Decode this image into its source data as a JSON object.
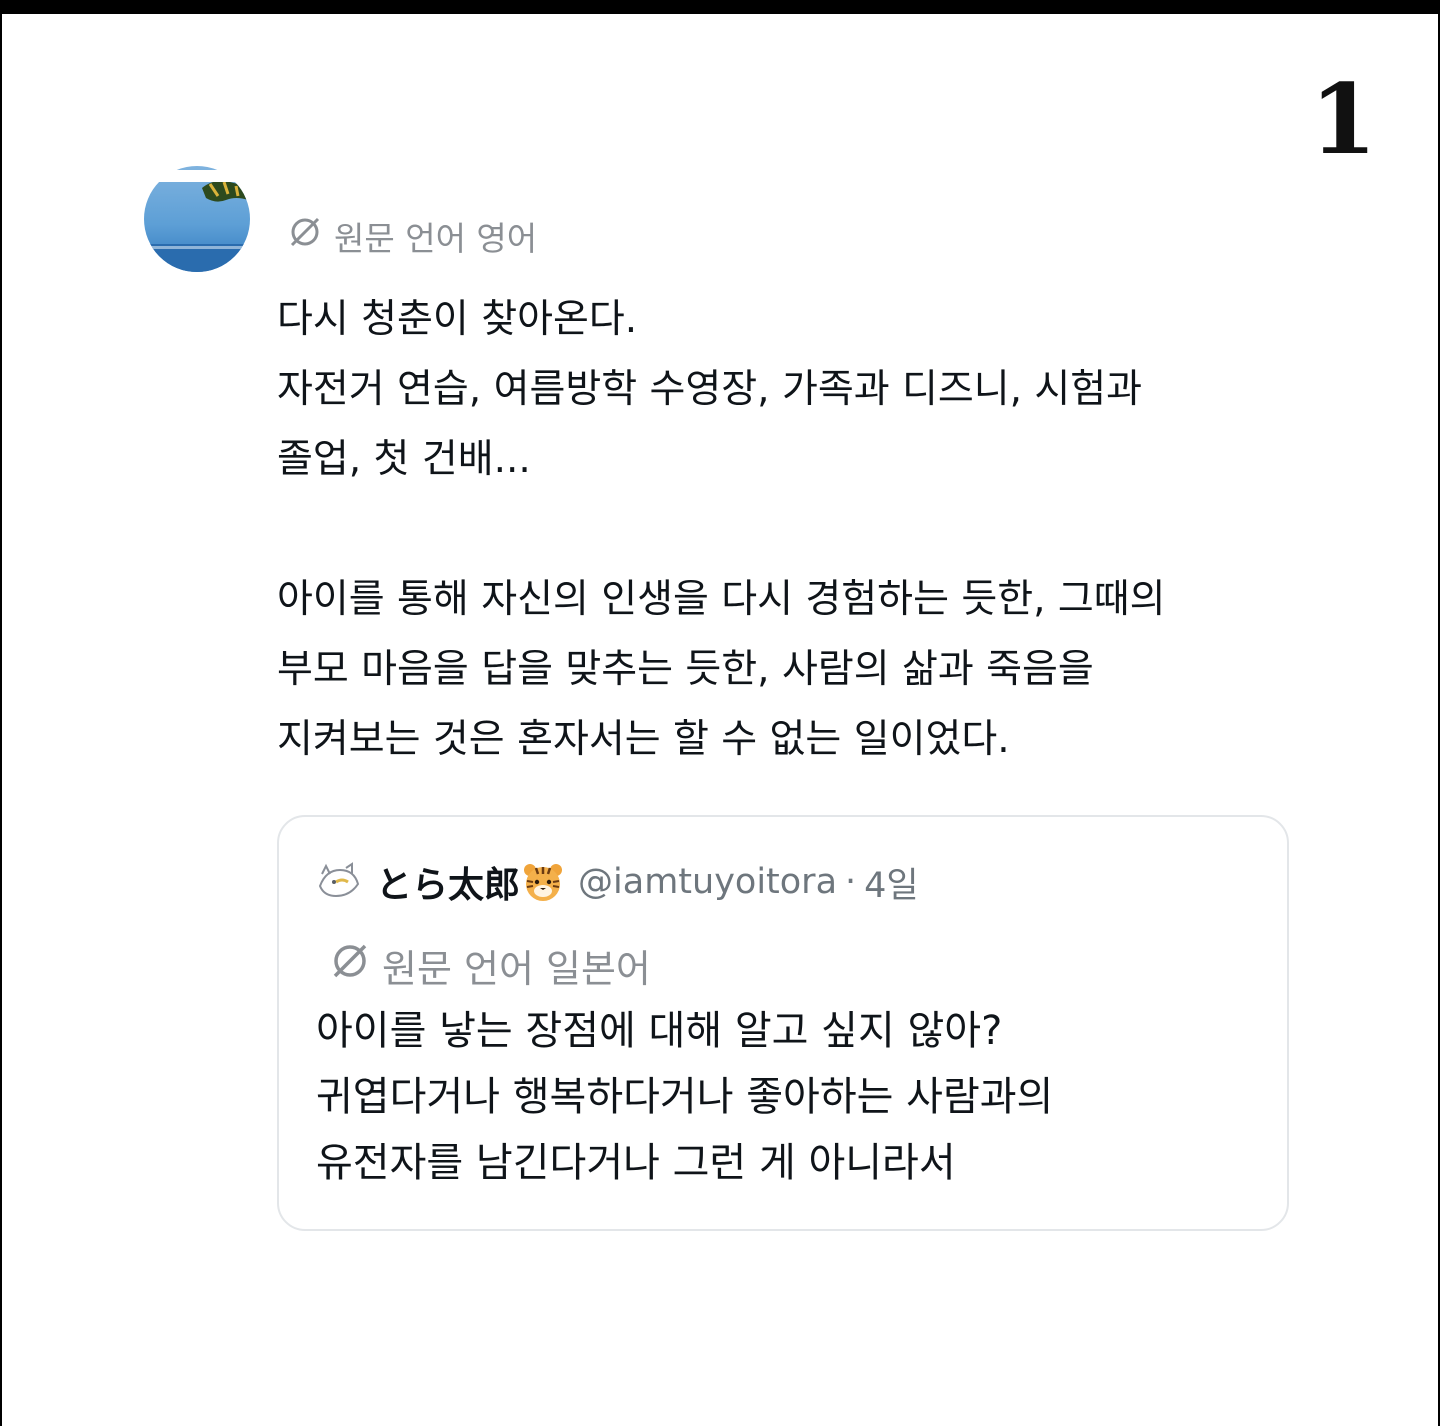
{
  "page_number": "1",
  "post": {
    "translate_label": "원문 언어 영어",
    "lines": [
      "다시 청춘이 찾아온다.",
      "자전거 연습, 여름방학 수영장, 가족과 디즈니, 시험과",
      "졸업, 첫 건배...",
      "",
      "아이를 통해 자신의 인생을 다시 경험하는 듯한, 그때의",
      "부모 마음을 답을 맞추는 듯한, 사람의 삶과 죽음을",
      "지켜보는 것은 혼자서는 할 수 없는 일이었다."
    ]
  },
  "quote": {
    "name": "とら太郎",
    "handle": "@iamtuyoitora",
    "separator": "·",
    "time": "4일",
    "translate_label": "원문 언어 일본어",
    "lines": [
      "아이를 낳는 장점에 대해 알고 싶지 않아?",
      "귀엽다거나 행복하다거나 좋아하는 사람과의",
      "유전자를 남긴다거나 그런 게 아니라서"
    ]
  },
  "icons": {
    "avatar": "avatar-sky-sea-icon",
    "translate": "translate-globe-icon",
    "quote_avatar": "quote-avatar-icon",
    "tiger": "tiger-emoji-icon"
  },
  "colors": {
    "frame": "#000000",
    "background": "#ffffff",
    "text": "#0f1419",
    "muted": "#8b8f94",
    "card_border": "#e3e6e9"
  }
}
